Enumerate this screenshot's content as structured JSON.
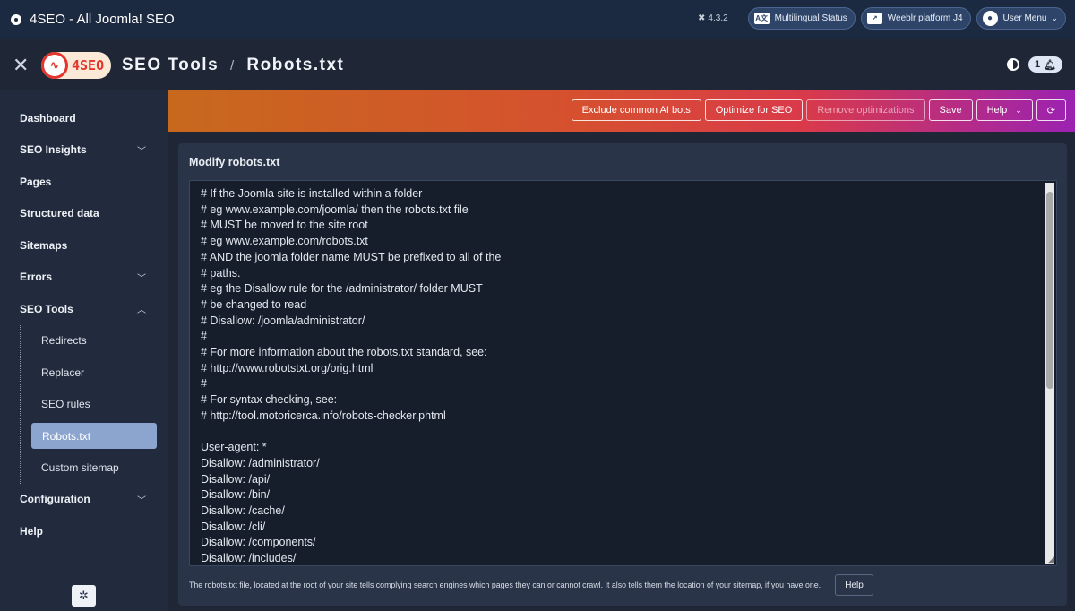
{
  "topbar": {
    "title": "4SEO - All Joomla! SEO",
    "version": "4.3.2",
    "multilingual_label": "Multilingual Status",
    "weeblr_label": "Weeblr platform J4",
    "user_menu_label": "User Menu"
  },
  "header": {
    "brand": "4SEO",
    "section": "SEO Tools",
    "separator": "/",
    "page": "Robots.txt",
    "notification_count": "1"
  },
  "sidebar": {
    "items": [
      {
        "label": "Dashboard"
      },
      {
        "label": "SEO Insights"
      },
      {
        "label": "Pages"
      },
      {
        "label": "Structured data"
      },
      {
        "label": "Sitemaps"
      },
      {
        "label": "Errors"
      },
      {
        "label": "SEO Tools"
      },
      {
        "label": "Configuration"
      },
      {
        "label": "Help"
      }
    ],
    "sub_items": [
      {
        "label": "Redirects"
      },
      {
        "label": "Replacer"
      },
      {
        "label": "SEO rules"
      },
      {
        "label": "Robots.txt"
      },
      {
        "label": "Custom sitemap"
      }
    ]
  },
  "toolbar": {
    "exclude_ai_bots": "Exclude common AI bots",
    "optimize_seo": "Optimize for SEO",
    "remove_optimizations": "Remove optimizations",
    "save": "Save",
    "help": "Help"
  },
  "card": {
    "title": "Modify robots.txt",
    "robots_text": "# If the Joomla site is installed within a folder\n# eg www.example.com/joomla/ then the robots.txt file\n# MUST be moved to the site root\n# eg www.example.com/robots.txt\n# AND the joomla folder name MUST be prefixed to all of the\n# paths.\n# eg the Disallow rule for the /administrator/ folder MUST\n# be changed to read\n# Disallow: /joomla/administrator/\n#\n# For more information about the robots.txt standard, see:\n# http://www.robotstxt.org/orig.html\n#\n# For syntax checking, see:\n# http://tool.motoricerca.info/robots-checker.phtml\n\nUser-agent: *\nDisallow: /administrator/\nDisallow: /api/\nDisallow: /bin/\nDisallow: /cache/\nDisallow: /cli/\nDisallow: /components/\nDisallow: /includes/",
    "footer_text": "The robots.txt file, located at the root of your site tells complying search engines which pages they can or cannot crawl. It also tells them the location of your sitemap, if you have one.",
    "help_label": "Help"
  }
}
